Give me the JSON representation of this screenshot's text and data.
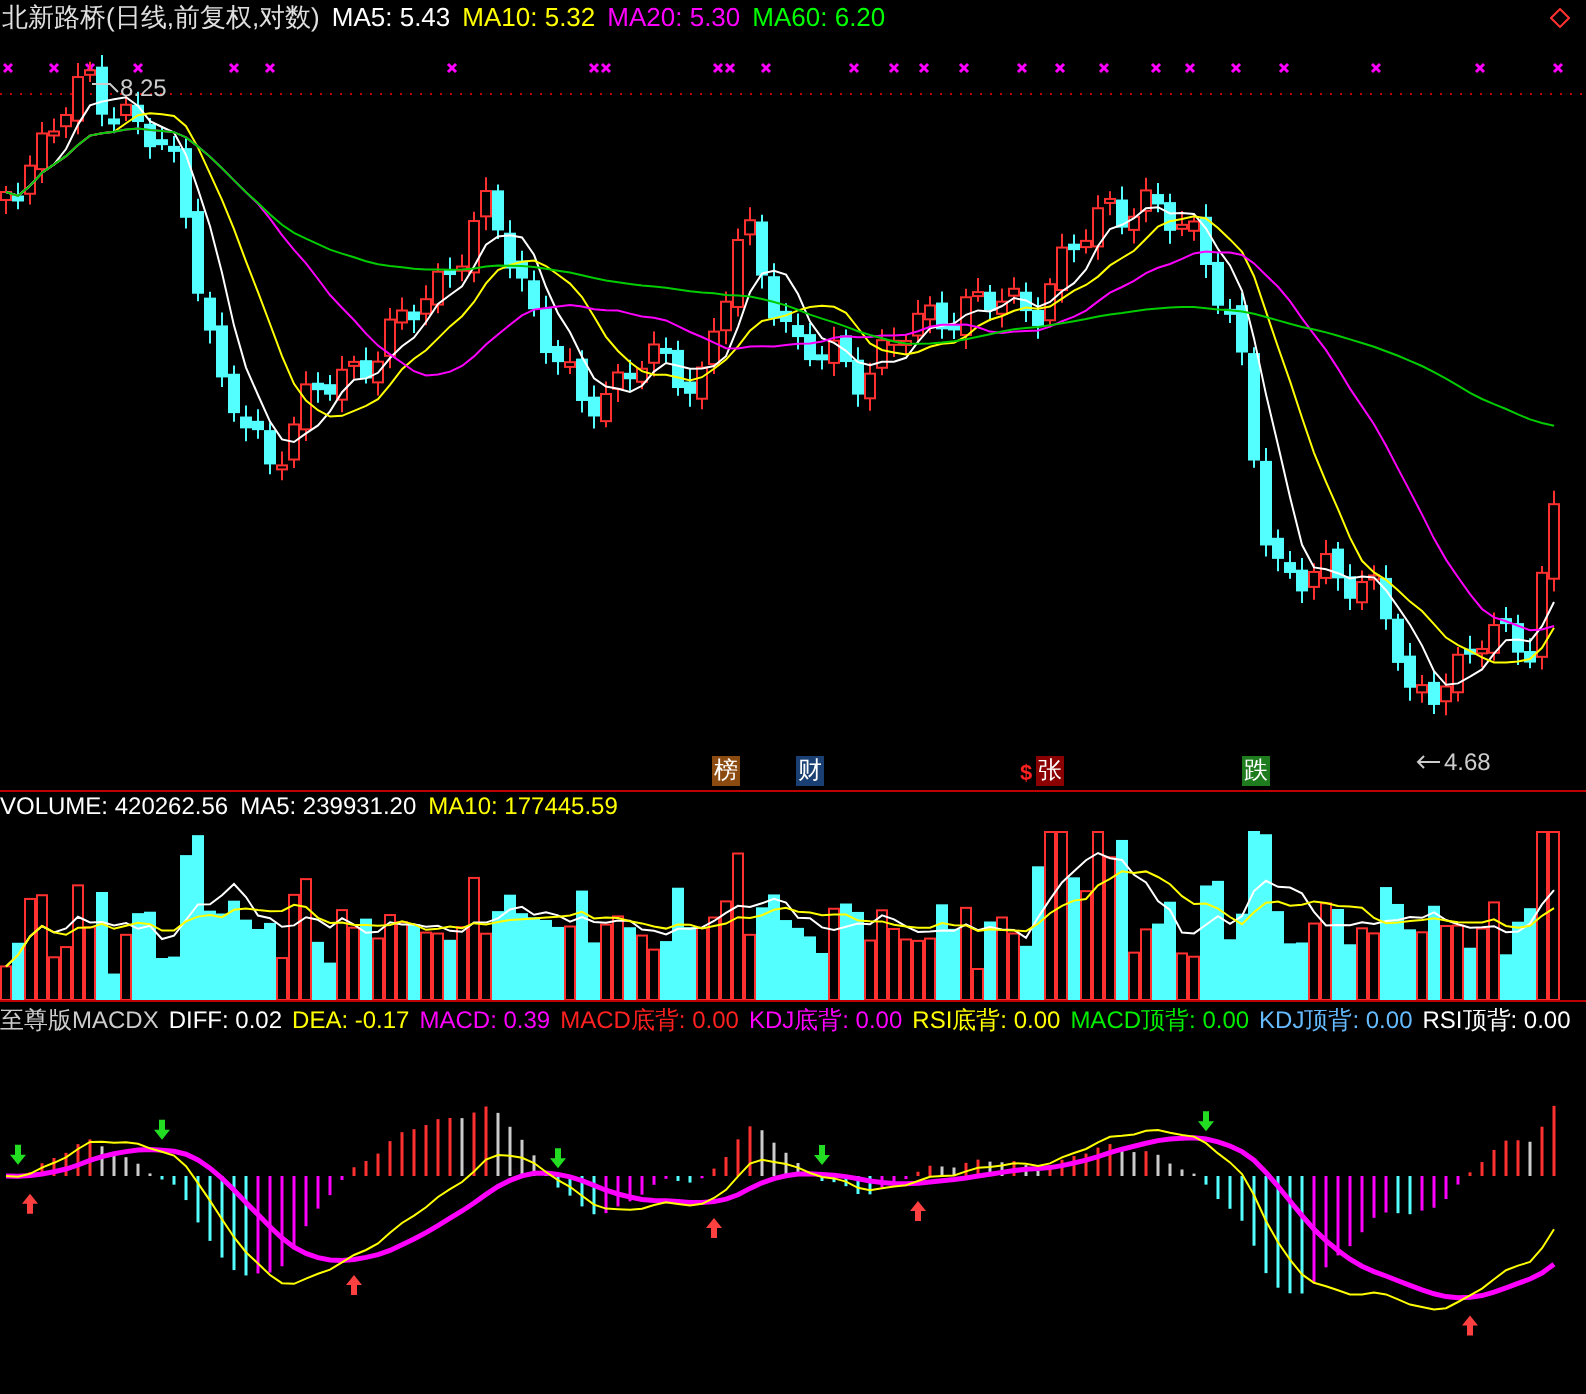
{
  "title": "北新路桥(日线,前复权,对数)",
  "price_legend": [
    {
      "label": "MA5: 5.43",
      "color": "#ffffff"
    },
    {
      "label": "MA10: 5.32",
      "color": "#ffff00"
    },
    {
      "label": "MA20: 5.30",
      "color": "#ff00ff"
    },
    {
      "label": "MA60: 6.20",
      "color": "#00ff00"
    }
  ],
  "price_high": "8.25",
  "price_low": "4.68",
  "event_markers": [
    {
      "kind": "badge",
      "text": "榜",
      "color": "#8b4a10"
    },
    {
      "kind": "badge",
      "text": "财",
      "color": "#1a3f73"
    },
    {
      "kind": "symbol",
      "text": "$",
      "color": "#ff2020"
    },
    {
      "kind": "badge",
      "text": "张",
      "color": "#8b0000"
    },
    {
      "kind": "badge",
      "text": "跌",
      "color": "#1e7b1e"
    }
  ],
  "volume_legend": [
    {
      "label": "VOLUME: 420262.56",
      "color": "#ffffff"
    },
    {
      "label": "MA5: 239931.20",
      "color": "#ffffff"
    },
    {
      "label": "MA10: 177445.59",
      "color": "#ffff00"
    }
  ],
  "macd_name": "至尊版MACDX",
  "macd_legend": [
    {
      "label": "DIFF: 0.02",
      "color": "#ffffff"
    },
    {
      "label": "DEA: -0.17",
      "color": "#ffff00"
    },
    {
      "label": "MACD: 0.39",
      "color": "#ff00ff"
    },
    {
      "label": "MACD底背: 0.00",
      "color": "#ff2020"
    },
    {
      "label": "KDJ底背: 0.00",
      "color": "#ff00ff"
    },
    {
      "label": "RSI底背: 0.00",
      "color": "#ffff00"
    },
    {
      "label": "MACD顶背: 0.00",
      "color": "#00ee00"
    },
    {
      "label": "KDJ顶背: 0.00",
      "color": "#66bbff"
    },
    {
      "label": "RSI顶背: 0.00",
      "color": "#ffffff"
    }
  ]
}
